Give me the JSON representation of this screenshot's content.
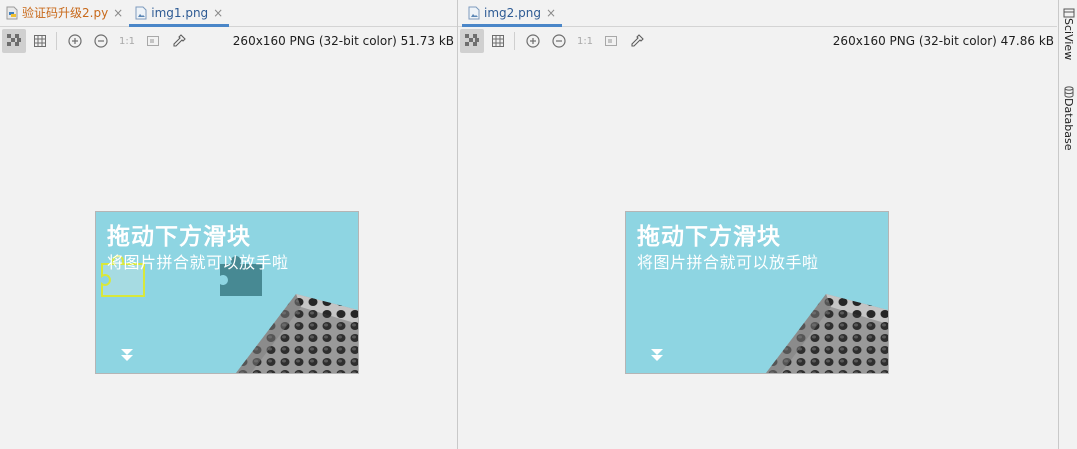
{
  "left_pane": {
    "tabs": [
      {
        "label": "验证码升级2.py",
        "kind": "python",
        "active": false,
        "close": "×"
      },
      {
        "label": "img1.png",
        "kind": "image",
        "active": true,
        "close": "×"
      }
    ],
    "toolbar": {
      "buttons": [
        "background-grid-icon",
        "grid-icon",
        "zoom-in-icon",
        "zoom-out-icon",
        "actual-size-icon",
        "fit-zoom-icon",
        "color-picker-icon"
      ],
      "actual_size_label": "1:1"
    },
    "image_info": "260x160 PNG (32-bit color) 51.73 kB",
    "image": {
      "title": "拖动下方滑块",
      "subtitle": "将图片拼合就可以放手啦",
      "has_puzzle_piece": true
    }
  },
  "right_pane": {
    "tabs": [
      {
        "label": "img2.png",
        "kind": "image",
        "active": true,
        "close": "×"
      }
    ],
    "toolbar": {
      "buttons": [
        "background-grid-icon",
        "grid-icon",
        "zoom-in-icon",
        "zoom-out-icon",
        "actual-size-icon",
        "fit-zoom-icon",
        "color-picker-icon"
      ],
      "actual_size_label": "1:1"
    },
    "image_info": "260x160 PNG (32-bit color) 47.86 kB",
    "image": {
      "title": "拖动下方滑块",
      "subtitle": "将图片拼合就可以放手啦",
      "has_puzzle_piece": false
    }
  },
  "right_sidebar": {
    "items": [
      {
        "label": "SciView",
        "icon": "sciview-icon"
      },
      {
        "label": "Database",
        "icon": "database-icon"
      }
    ]
  },
  "colors": {
    "sky": "#8ed5e2",
    "active_tab_underline": "#4a86c8",
    "python_tab_text": "#c8691a",
    "image_tab_text": "#2e5b94"
  }
}
